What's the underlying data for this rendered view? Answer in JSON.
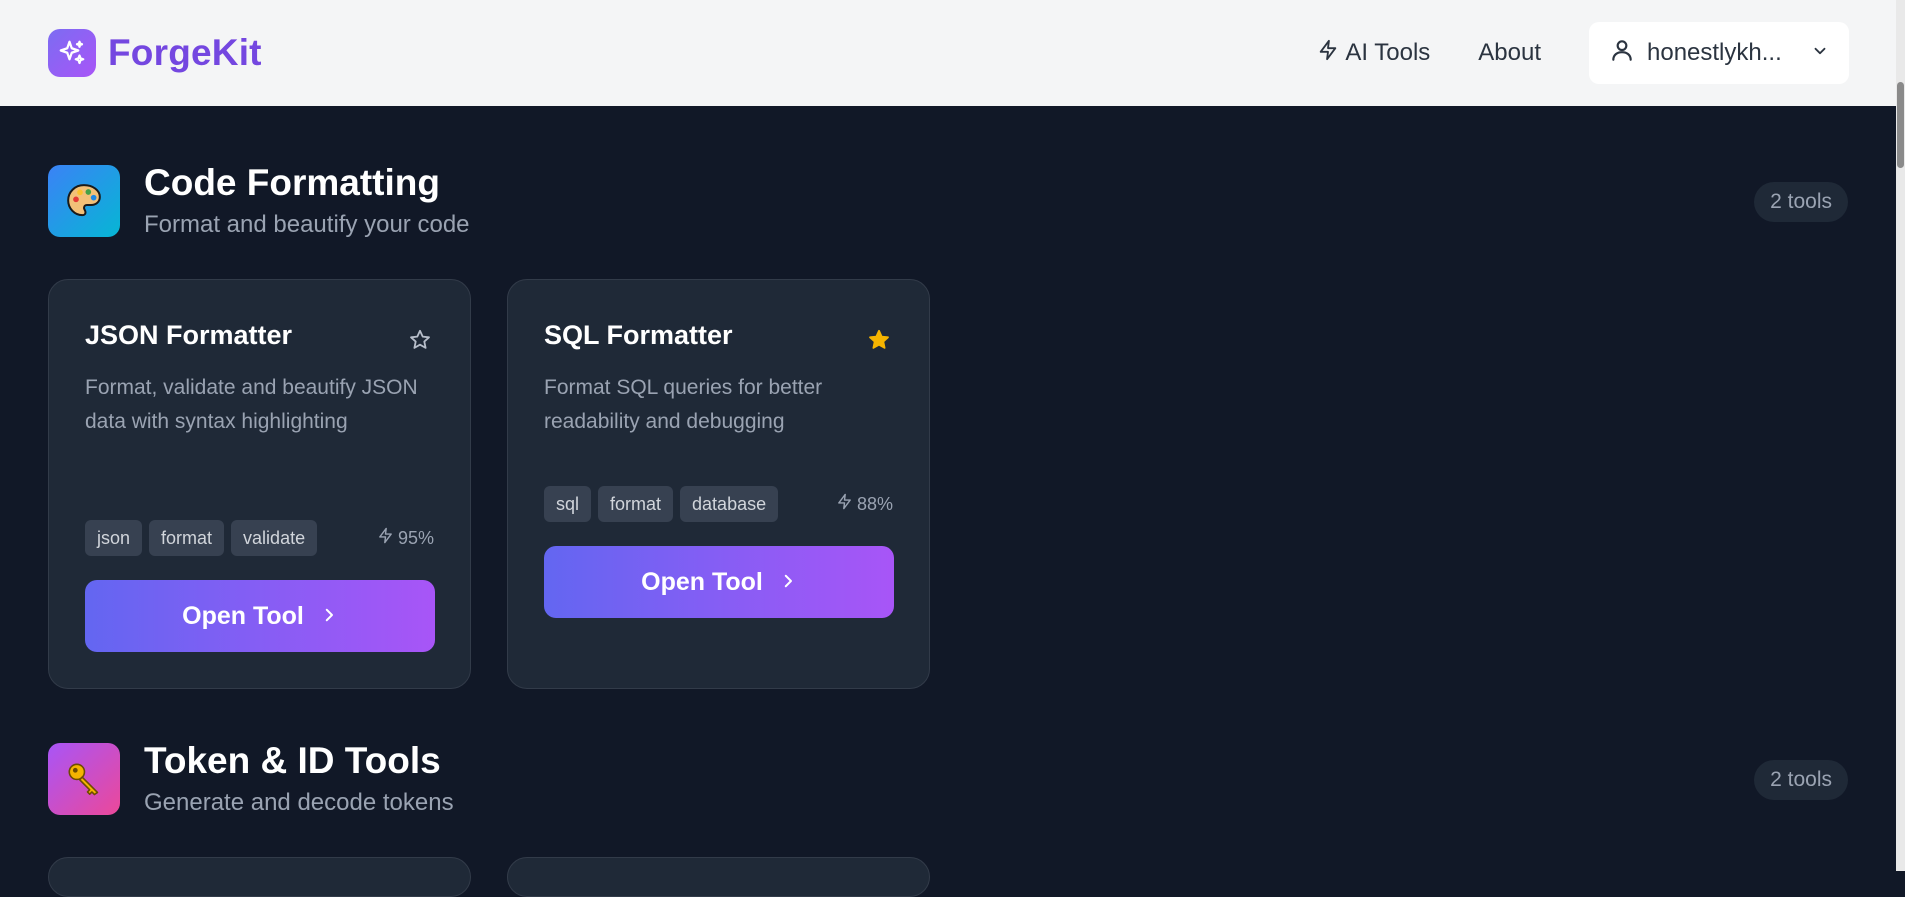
{
  "header": {
    "brand": "ForgeKit",
    "nav": {
      "ai_tools": "AI Tools",
      "about": "About"
    },
    "user": {
      "name": "honestlykh..."
    }
  },
  "sections": [
    {
      "title": "Code Formatting",
      "subtitle": "Format and beautify your code",
      "count": "2 tools",
      "icon": "palette-icon",
      "cards": [
        {
          "title": "JSON Formatter",
          "description": "Format, validate and beautify JSON data with syntax highlighting",
          "tags": [
            "json",
            "format",
            "validate"
          ],
          "score": "95%",
          "favorited": false,
          "button": "Open Tool"
        },
        {
          "title": "SQL Formatter",
          "description": "Format SQL queries for better readability and debugging",
          "tags": [
            "sql",
            "format",
            "database"
          ],
          "score": "88%",
          "favorited": true,
          "button": "Open Tool"
        }
      ]
    },
    {
      "title": "Token & ID Tools",
      "subtitle": "Generate and decode tokens",
      "count": "2 tools",
      "icon": "key-icon"
    }
  ],
  "colors": {
    "background": "#111827",
    "card": "#1f2937",
    "accent_start": "#6366f1",
    "accent_end": "#a855f7",
    "star_active": "#f5b400"
  }
}
